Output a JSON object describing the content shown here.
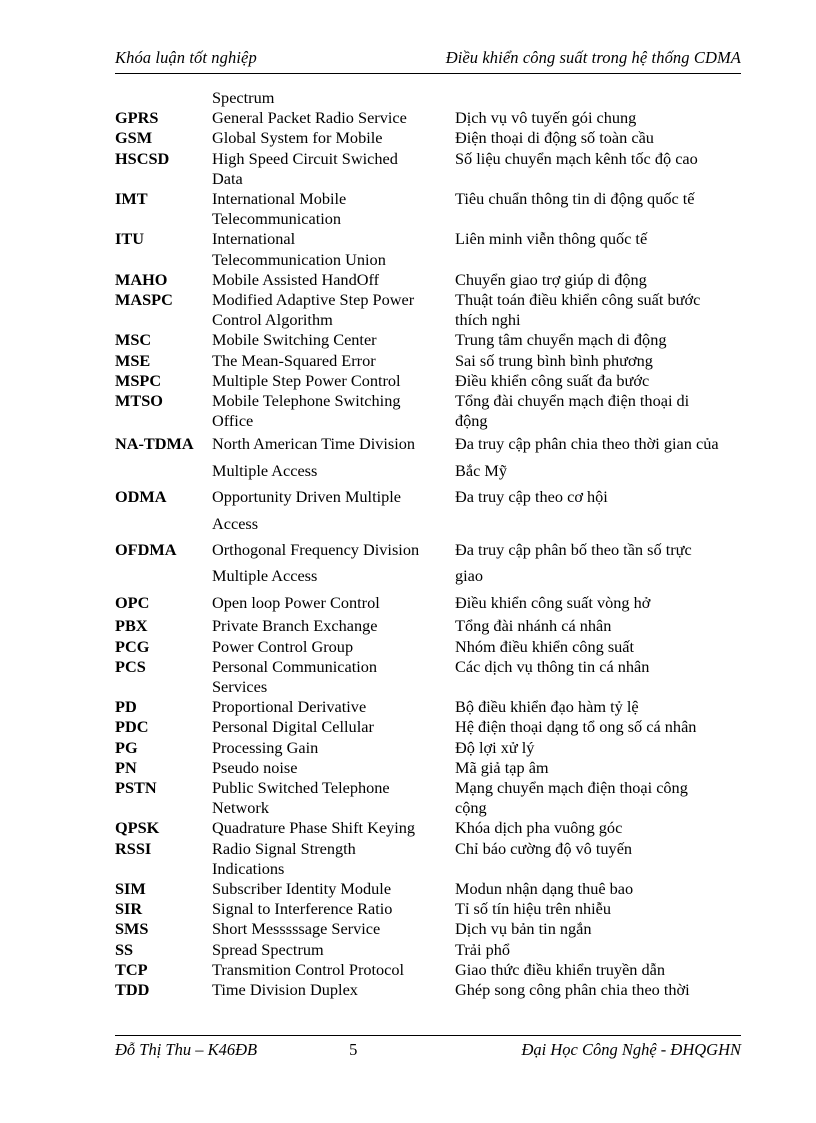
{
  "header": {
    "left": "Khóa luận tốt nghiệp",
    "right": "Điều khiển công suất trong hệ thống CDMA"
  },
  "footer": {
    "left": "Đỗ Thị Thu – K46ĐB",
    "page_number": "5",
    "right": "Đại Học Công Nghệ - ĐHQGHN"
  },
  "glossary": {
    "continued_entry": {
      "english_line2": "Spectrum"
    },
    "rows": [
      {
        "acronym": "GPRS",
        "english": "General Packet Radio Service",
        "english_line2": "",
        "vietnamese": "Dịch vụ vô tuyến gói chung",
        "vietnamese_line2": "",
        "spacing": "tight"
      },
      {
        "acronym": "GSM",
        "english": "Global System for Mobile",
        "english_line2": "",
        "vietnamese": "Điện thoại di động số toàn cầu",
        "vietnamese_line2": "",
        "spacing": "tight"
      },
      {
        "acronym": "HSCSD",
        "english": "High Speed Circuit Swiched",
        "english_line2": "Data",
        "vietnamese": "Số liệu chuyển mạch kênh tốc độ cao",
        "vietnamese_line2": "",
        "spacing": "tight"
      },
      {
        "acronym": "IMT",
        "english": "International Mobile",
        "english_line2": "Telecommunication",
        "vietnamese": "Tiêu chuẩn thông tin di động quốc tế",
        "vietnamese_line2": "",
        "spacing": "tight"
      },
      {
        "acronym": "ITU",
        "english": "International",
        "english_line2": "Telecommunication Union",
        "vietnamese": "Liên minh viễn thông quốc tế",
        "vietnamese_line2": "",
        "spacing": "tight"
      },
      {
        "acronym": "MAHO",
        "english": "Mobile Assisted HandOff",
        "english_line2": "",
        "vietnamese": "Chuyển giao trợ giúp di động",
        "vietnamese_line2": "",
        "spacing": "tight"
      },
      {
        "acronym": "MASPC",
        "english": "Modified Adaptive Step Power",
        "english_line2": "Control Algorithm",
        "vietnamese": "Thuật toán điều khiển công suất bước",
        "vietnamese_line2": "thích nghi",
        "spacing": "tight"
      },
      {
        "acronym": "MSC",
        "english": "Mobile Switching Center",
        "english_line2": "",
        "vietnamese": "Trung tâm chuyển mạch di động",
        "vietnamese_line2": "",
        "spacing": "tight"
      },
      {
        "acronym": "MSE",
        "english": "The Mean-Squared Error",
        "english_line2": "",
        "vietnamese": "Sai số trung bình bình phương",
        "vietnamese_line2": "",
        "spacing": "tight"
      },
      {
        "acronym": "MSPC",
        "english": "Multiple Step Power Control",
        "english_line2": "",
        "vietnamese": "Điều khiển công suất đa bước",
        "vietnamese_line2": "",
        "spacing": "tight"
      },
      {
        "acronym": "MTSO",
        "english": "Mobile Telephone Switching",
        "english_line2": "Office",
        "vietnamese": "Tổng đài chuyển mạch điện thoại di",
        "vietnamese_line2": "động",
        "spacing": "tight"
      },
      {
        "acronym": "NA-TDMA",
        "english": "North American Time Division",
        "english_line2": "Multiple Access",
        "vietnamese": "Đa truy cập phân chia theo thời gian của",
        "vietnamese_line2": "Bắc Mỹ",
        "spacing": "loose"
      },
      {
        "acronym": "ODMA",
        "english": "Opportunity Driven Multiple",
        "english_line2": "Access",
        "vietnamese": "Đa truy cập theo cơ hội",
        "vietnamese_line2": "",
        "spacing": "loose"
      },
      {
        "acronym": "OFDMA",
        "english": "Orthogonal Frequency Division",
        "english_line2": "Multiple Access",
        "vietnamese": "Đa truy cập phân bố theo tần số trực",
        "vietnamese_line2": "giao",
        "spacing": "loose"
      },
      {
        "acronym": "OPC",
        "english": "Open loop Power Control",
        "english_line2": "",
        "vietnamese": "Điều khiển công suất vòng hở",
        "vietnamese_line2": "",
        "spacing": "loose"
      },
      {
        "acronym": "PBX",
        "english": "Private Branch Exchange",
        "english_line2": "",
        "vietnamese": "Tổng đài nhánh cá nhân",
        "vietnamese_line2": "",
        "spacing": "tight"
      },
      {
        "acronym": "PCG",
        "english": "Power Control Group",
        "english_line2": "",
        "vietnamese": "Nhóm điều khiển công suất",
        "vietnamese_line2": "",
        "spacing": "tight"
      },
      {
        "acronym": "PCS",
        "english": "Personal Communication",
        "english_line2": "Services",
        "vietnamese": "Các dịch vụ thông tin cá nhân",
        "vietnamese_line2": "",
        "spacing": "tight"
      },
      {
        "acronym": "PD",
        "english": "Proportional Derivative",
        "english_line2": "",
        "vietnamese": "Bộ điều khiển đạo hàm tỷ lệ",
        "vietnamese_line2": "",
        "spacing": "tight"
      },
      {
        "acronym": "PDC",
        "english": "Personal Digital Cellular",
        "english_line2": "",
        "vietnamese": "Hệ điện thoại dạng tổ ong số cá nhân",
        "vietnamese_line2": "",
        "spacing": "tight"
      },
      {
        "acronym": "PG",
        "english": "Processing Gain",
        "english_line2": "",
        "vietnamese": "Độ lợi xử lý",
        "vietnamese_line2": "",
        "spacing": "tight"
      },
      {
        "acronym": "PN",
        "english": "Pseudo noise",
        "english_line2": "",
        "vietnamese": "Mã giả tạp âm",
        "vietnamese_line2": "",
        "spacing": "tight"
      },
      {
        "acronym": "PSTN",
        "english": "Public Switched Telephone",
        "english_line2": "Network",
        "vietnamese": "Mạng chuyển mạch điện thoại công",
        "vietnamese_line2": "cộng",
        "spacing": "tight"
      },
      {
        "acronym": "QPSK",
        "english": "Quadrature Phase Shift Keying",
        "english_line2": "",
        "vietnamese": "Khóa dịch pha vuông góc",
        "vietnamese_line2": "",
        "spacing": "tight"
      },
      {
        "acronym": "RSSI",
        "english": "Radio Signal Strength",
        "english_line2": "Indications",
        "vietnamese": "Chỉ báo cường độ vô tuyến",
        "vietnamese_line2": "",
        "spacing": "tight"
      },
      {
        "acronym": "SIM",
        "english": "Subscriber Identity Module",
        "english_line2": "",
        "vietnamese": "Modun nhận dạng thuê bao",
        "vietnamese_line2": "",
        "spacing": "tight"
      },
      {
        "acronym": "SIR",
        "english": "Signal to Interference Ratio",
        "english_line2": "",
        "vietnamese": "Tỉ số tín hiệu trên nhiễu",
        "vietnamese_line2": "",
        "spacing": "tight"
      },
      {
        "acronym": "SMS",
        "english": "Short Messsssage Service",
        "english_line2": "",
        "vietnamese": "Dịch vụ bản tin ngắn",
        "vietnamese_line2": "",
        "spacing": "tight"
      },
      {
        "acronym": "SS",
        "english": "Spread Spectrum",
        "english_line2": "",
        "vietnamese": "Trải phổ",
        "vietnamese_line2": "",
        "spacing": "tight"
      },
      {
        "acronym": "TCP",
        "english": "Transmition Control Protocol",
        "english_line2": "",
        "vietnamese": "Giao thức điều khiển truyền dẫn",
        "vietnamese_line2": "",
        "spacing": "tight"
      },
      {
        "acronym": "TDD",
        "english": "Time Division Duplex",
        "english_line2": "",
        "vietnamese": "Ghép song công phân chia theo thời",
        "vietnamese_line2": "",
        "spacing": "tight"
      }
    ]
  }
}
